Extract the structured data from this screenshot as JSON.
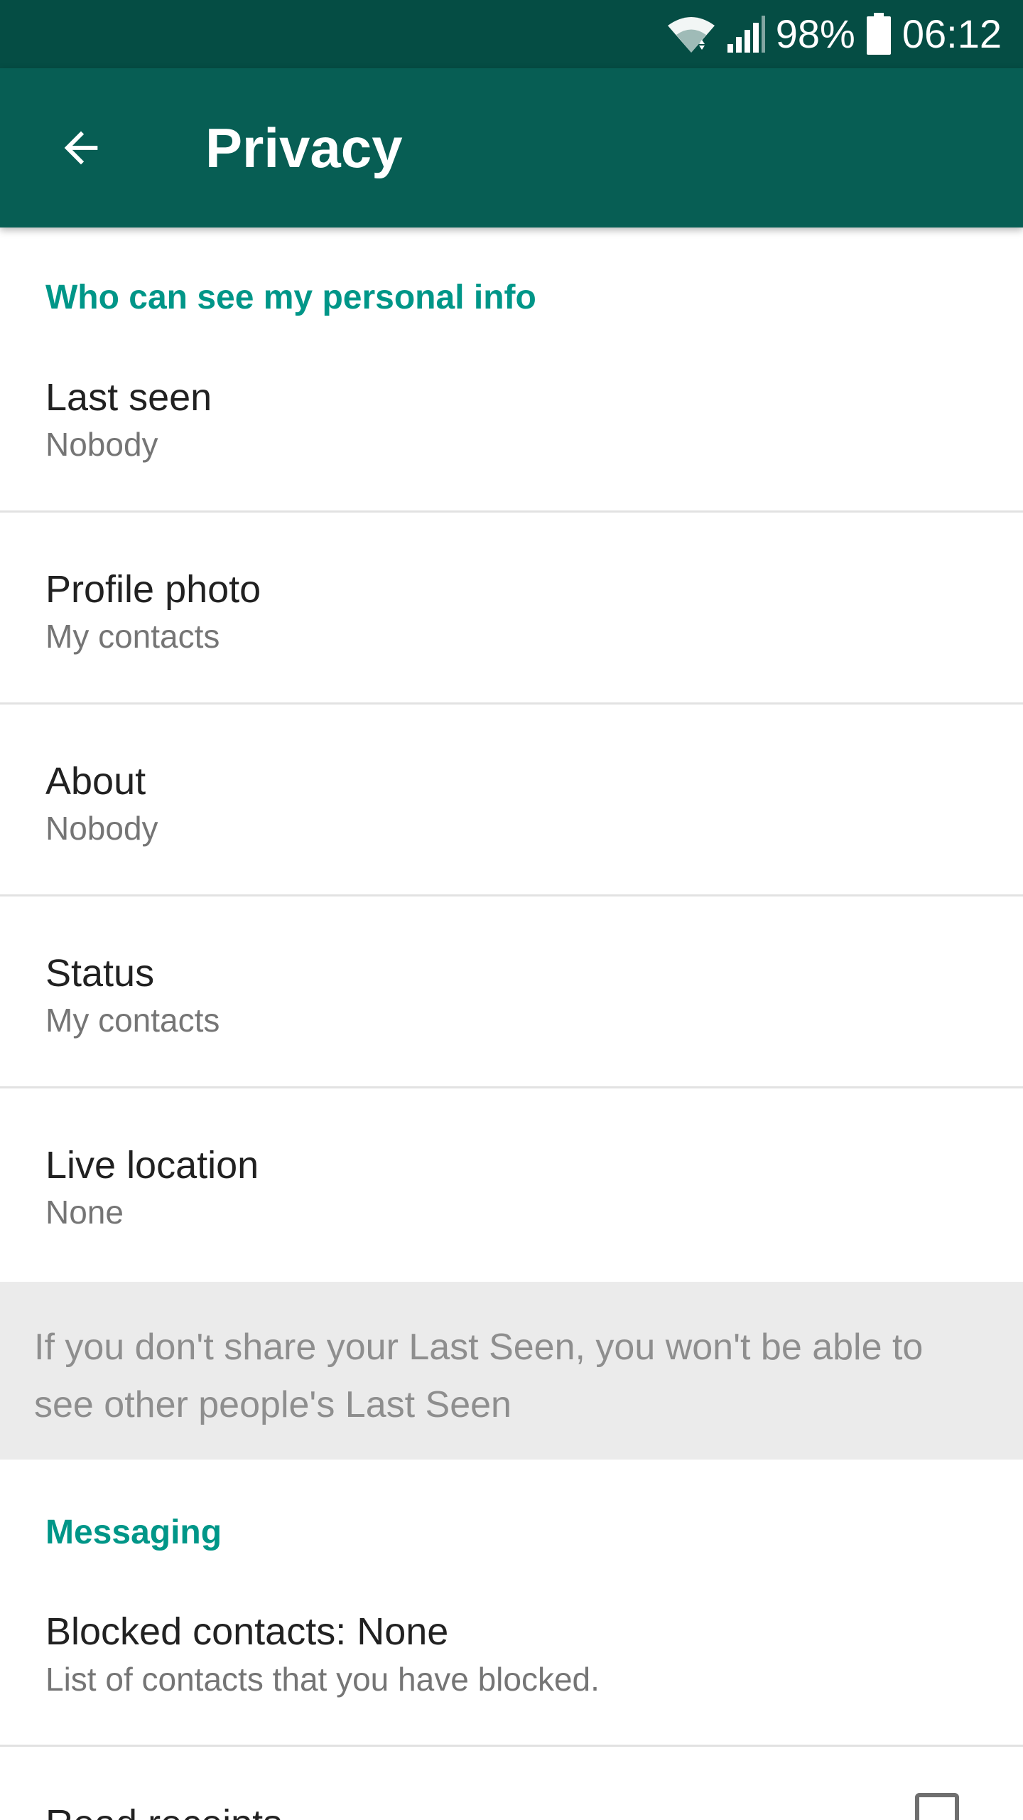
{
  "status_bar": {
    "battery_percent": "98%",
    "time": "06:12"
  },
  "toolbar": {
    "title": "Privacy",
    "back_icon": "arrow-back-icon"
  },
  "sections": {
    "personal_info": {
      "header": "Who can see my personal info",
      "items": [
        {
          "title": "Last seen",
          "summary": "Nobody"
        },
        {
          "title": "Profile photo",
          "summary": "My contacts"
        },
        {
          "title": "About",
          "summary": "Nobody"
        },
        {
          "title": "Status",
          "summary": "My contacts"
        },
        {
          "title": "Live location",
          "summary": "None"
        }
      ],
      "note": "If you don't share your Last Seen, you won't be able to see other people's Last Seen"
    },
    "messaging": {
      "header": "Messaging",
      "items": [
        {
          "title": "Blocked contacts: None",
          "summary": "List of contacts that you have blocked."
        },
        {
          "title": "Read receipts",
          "checked": false
        }
      ]
    }
  },
  "colors": {
    "status_bar": "#054d44",
    "toolbar": "#075e54",
    "accent": "#009688"
  }
}
